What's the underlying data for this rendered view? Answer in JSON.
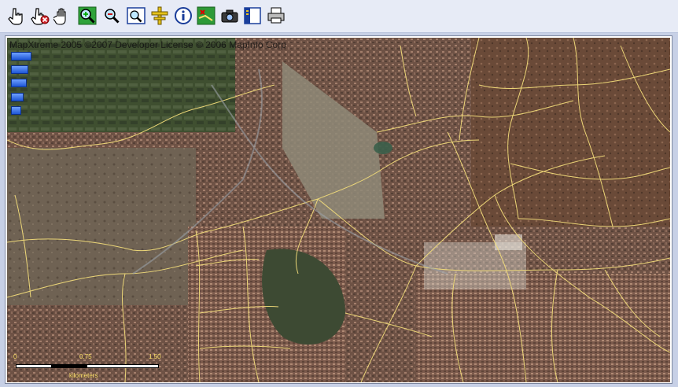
{
  "toolbar": {
    "tools": [
      {
        "name": "select-tool",
        "icon": "pointing-hand-icon"
      },
      {
        "name": "deselect-tool",
        "icon": "hand-remove-icon"
      },
      {
        "name": "pan-tool",
        "icon": "open-hand-icon"
      },
      {
        "name": "zoom-in-tool",
        "icon": "zoom-in-icon"
      },
      {
        "name": "zoom-out-tool",
        "icon": "zoom-out-icon"
      },
      {
        "name": "zoom-extent-tool",
        "icon": "zoom-window-icon"
      },
      {
        "name": "center-tool",
        "icon": "crosshair-icon"
      },
      {
        "name": "info-tool",
        "icon": "info-icon"
      },
      {
        "name": "measure-tool",
        "icon": "measure-icon"
      },
      {
        "name": "export-image-tool",
        "icon": "camera-icon"
      },
      {
        "name": "layers-tool",
        "icon": "layers-panel-icon"
      },
      {
        "name": "print-tool",
        "icon": "printer-icon"
      }
    ]
  },
  "map": {
    "copyright": "MapXtreme 2005 ©2007 Developer License © 2006 MapInfo Corp",
    "zoom_levels": 5,
    "scale": {
      "labels": [
        "0",
        "0.75",
        "1.50"
      ],
      "unit": "kilometers"
    }
  },
  "colors": {
    "toolbar_bg": "#e7ebf6",
    "page_bg": "#c7d0e6",
    "road_lines": "#f3dd7a",
    "scale_text": "#ffe36a",
    "zoom_bar": "#2a62e0"
  }
}
